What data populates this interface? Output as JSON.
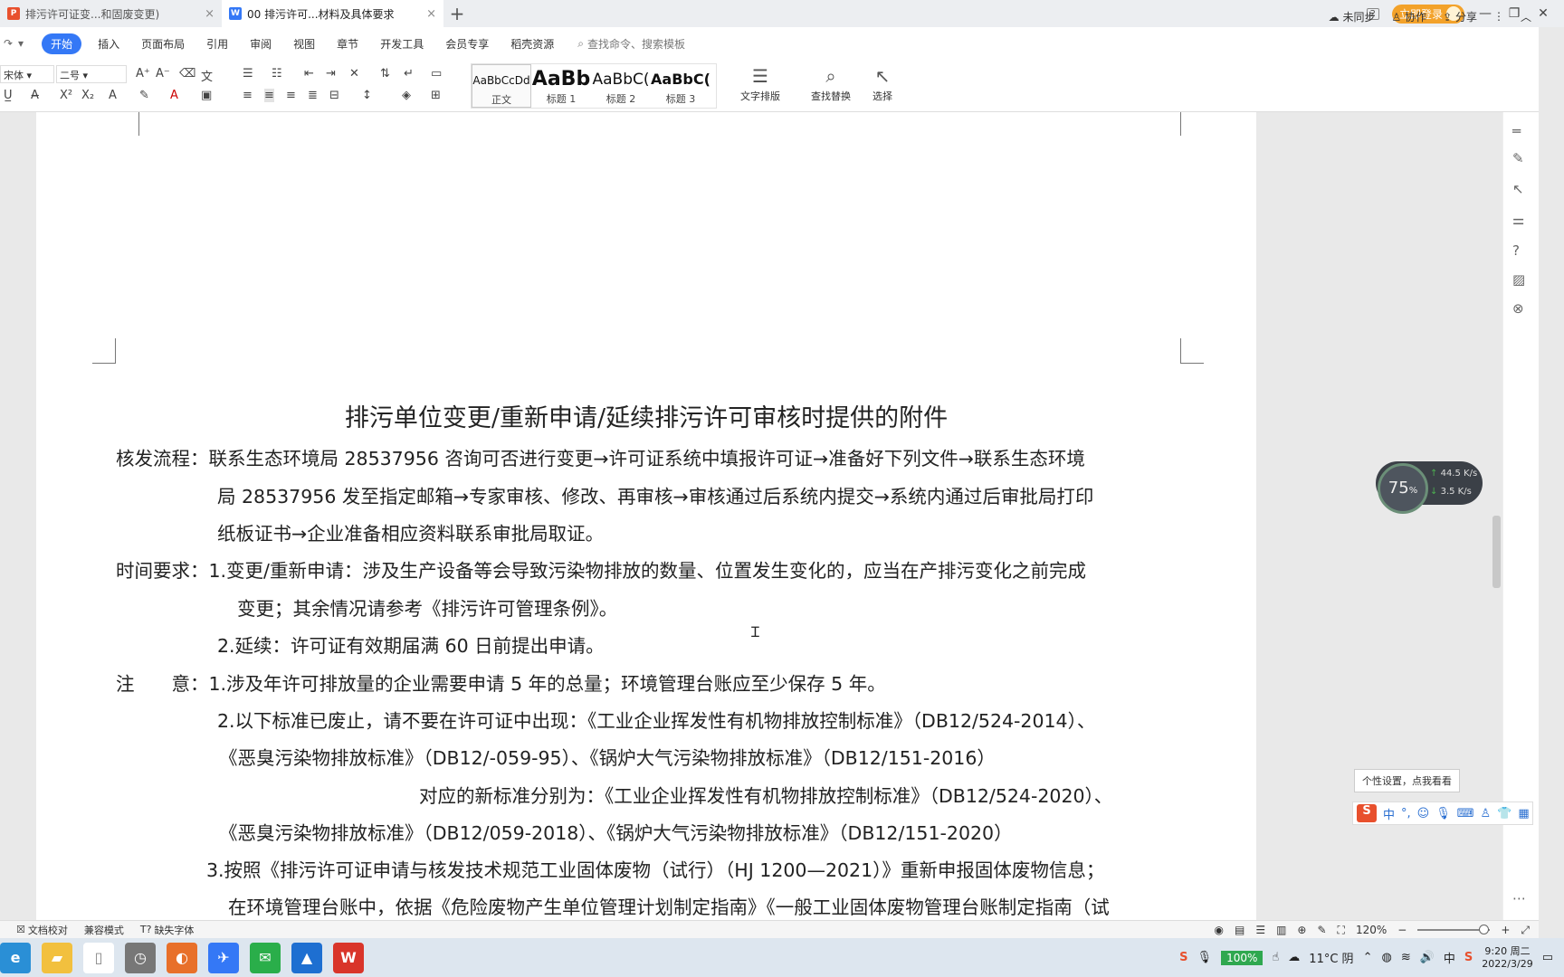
{
  "tabs": [
    {
      "label": "排污许可证变...和固废变更)",
      "icon": "P",
      "icon_color": "#e8502d",
      "active": false
    },
    {
      "label": "00 排污许可...材料及具体要求",
      "icon": "W",
      "icon_color": "#3478f6",
      "active": true
    }
  ],
  "titlebar": {
    "badge": "2",
    "login_label": "立即登录"
  },
  "menu": {
    "items": [
      "开始",
      "插入",
      "页面布局",
      "引用",
      "审阅",
      "视图",
      "章节",
      "开发工具",
      "会员专享",
      "稻壳资源"
    ],
    "search_placeholder": "查找命令、搜索模板",
    "right": [
      "未同步",
      "协作",
      "分享"
    ]
  },
  "ribbon": {
    "font_name": "宋体",
    "font_size": "二号",
    "styles": [
      {
        "sample": "AaBbCcDd",
        "name": "正文"
      },
      {
        "sample": "AaBb",
        "name": "标题 1"
      },
      {
        "sample": "AaBbC(",
        "name": "标题 2"
      },
      {
        "sample": "AaBbC(",
        "name": "标题 3"
      }
    ],
    "tools": [
      "文字排版",
      "查找替换",
      "选择"
    ]
  },
  "document": {
    "title": "排污单位变更/重新申请/延续排污许可审核时提供的附件",
    "lines": [
      "核发流程：联系生态环境局 28537956 咨询可否进行变更→许可证系统中填报许可证→准备好下列文件→联系生态环境",
      "局 28537956 发至指定邮箱→专家审核、修改、再审核→审核通过后系统内提交→系统内通过后审批局打印",
      "纸板证书→企业准备相应资料联系审批局取证。",
      "时间要求：1.变更/重新申请：涉及生产设备等会导致污染物排放的数量、位置发生变化的，应当在产排污变化之前完成",
      "变更；其余情况请参考《排污许可管理条例》。",
      "2.延续：许可证有效期届满 60 日前提出申请。",
      "注　　意：1.涉及年许可排放量的企业需要申请 5 年的总量；环境管理台账应至少保存 5 年。",
      "2.以下标准已废止，请不要在许可证中出现：《工业企业挥发性有机物排放控制标准》（DB12/524-2014）、",
      "《恶臭污染物排放标准》（DB12/-059-95）、《锅炉大气污染物排放标准》（DB12/151-2016）",
      "对应的新标准分别为：《工业企业挥发性有机物排放控制标准》（DB12/524-2020）、",
      "《恶臭污染物排放标准》（DB12/059-2018）、《锅炉大气污染物排放标准》（DB12/151-2020）",
      "3.按照《排污许可证申请与核发技术规范工业固体废物（试行）（HJ 1200—2021）》重新申报固体废物信息；",
      "在环境管理台账中，依据《危险废物产生单位管理计划制定指南》《一般工业固体废物管理台账制定指南（试"
    ]
  },
  "netwidget": {
    "percent": "75",
    "unit": "%",
    "up": "44.5",
    "down": "3.5",
    "speed_unit": "K/s"
  },
  "ime": {
    "tooltip": "个性设置，点我看看",
    "mode": "中",
    "punct": "°,"
  },
  "statusbar": {
    "left": [
      "文档校对",
      "兼容模式",
      "缺失字体"
    ],
    "zoom": "120%"
  },
  "taskbar": {
    "battery": "100%",
    "weather": "11°C 阴",
    "ime": "中",
    "time": "9:20 周二",
    "date": "2022/3/29"
  }
}
